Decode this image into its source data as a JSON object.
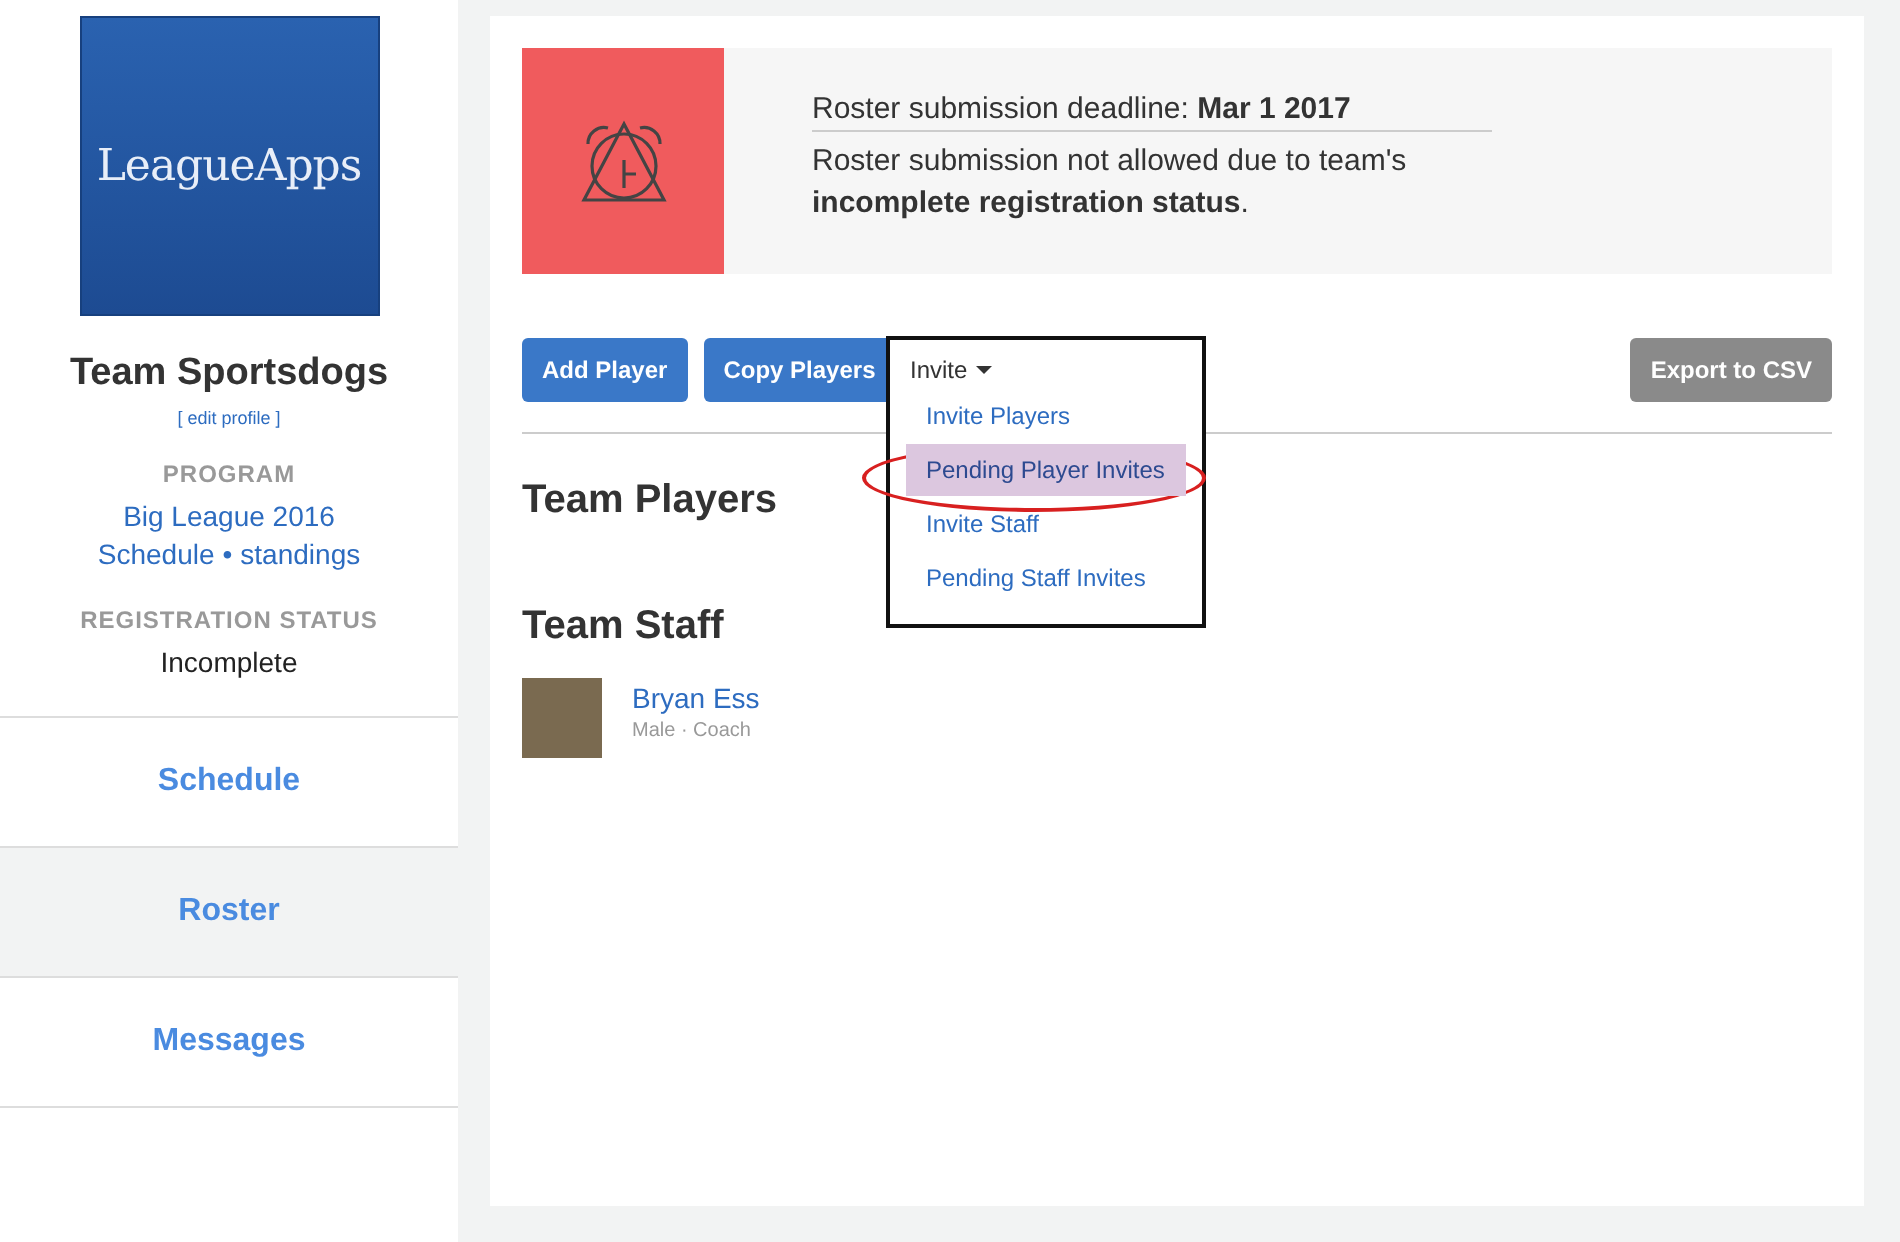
{
  "sidebar": {
    "logo_text": "LeagueApps",
    "team_name": "Team Sportsdogs",
    "edit_link": "[ edit profile ]",
    "program_label": "PROGRAM",
    "program_name": "Big League 2016",
    "schedule_link": "Schedule",
    "separator": "•",
    "standings_link": "standings",
    "status_label": "REGISTRATION STATUS",
    "status_value": "Incomplete",
    "nav": [
      {
        "label": "Schedule",
        "selected": false
      },
      {
        "label": "Roster",
        "selected": true
      },
      {
        "label": "Messages",
        "selected": false
      }
    ]
  },
  "alert": {
    "deadline": "Roster submission deadline: **Mar 1 2017**",
    "message": "Roster submission not allowed due to team's **incomplete registration status**."
  },
  "toolbar": {
    "buttons": [
      "Add Player",
      "Copy Players"
    ],
    "invite_label": "Invite",
    "export_button": "Export to CSV"
  },
  "invite_menu": {
    "items": [
      {
        "label": "Invite Players",
        "selected": false
      },
      {
        "label": "Pending Player Invites",
        "selected": true
      },
      {
        "label": "Invite Staff",
        "selected": false
      },
      {
        "label": "Pending Staff Invites",
        "selected": false
      }
    ]
  },
  "players_heading": "Team Players",
  "staff_heading": "Team Staff",
  "staff": [
    {
      "name": "Bryan Ess",
      "details": "Male · Coach"
    }
  ]
}
